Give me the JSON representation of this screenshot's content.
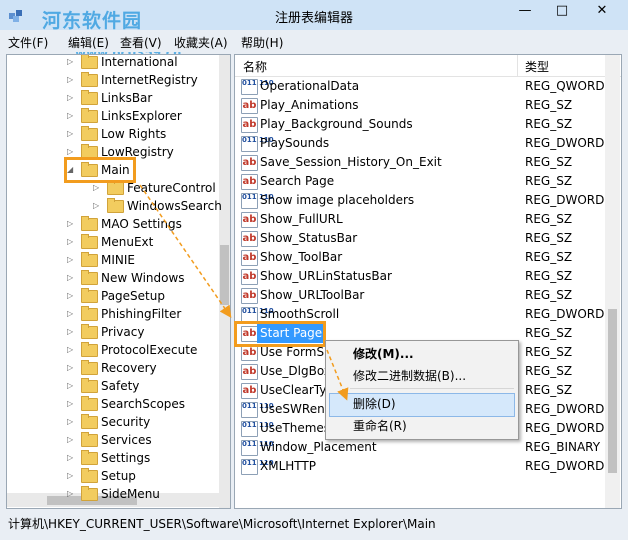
{
  "window": {
    "title": "注册表编辑器",
    "watermark": "河东软件园",
    "watermark_url": "www.pc0359.cn",
    "minimize": "—",
    "restore": "□",
    "close": "✕"
  },
  "menu": [
    "文件(F)",
    "编辑(E)",
    "查看(V)",
    "收藏夹(A)",
    "帮助(H)"
  ],
  "tree": [
    {
      "label": "International",
      "level": 1
    },
    {
      "label": "InternetRegistry",
      "level": 1
    },
    {
      "label": "LinksBar",
      "level": 1
    },
    {
      "label": "LinksExplorer",
      "level": 1
    },
    {
      "label": "Low Rights",
      "level": 1
    },
    {
      "label": "LowRegistry",
      "level": 1
    },
    {
      "label": "Main",
      "level": 1,
      "expanded": true,
      "highlighted": true
    },
    {
      "label": "FeatureControl",
      "level": 2
    },
    {
      "label": "WindowsSearch",
      "level": 2
    },
    {
      "label": "MAO Settings",
      "level": 1
    },
    {
      "label": "MenuExt",
      "level": 1
    },
    {
      "label": "MINIE",
      "level": 1
    },
    {
      "label": "New Windows",
      "level": 1
    },
    {
      "label": "PageSetup",
      "level": 1
    },
    {
      "label": "PhishingFilter",
      "level": 1
    },
    {
      "label": "Privacy",
      "level": 1
    },
    {
      "label": "ProtocolExecute",
      "level": 1
    },
    {
      "label": "Recovery",
      "level": 1
    },
    {
      "label": "Safety",
      "level": 1
    },
    {
      "label": "SearchScopes",
      "level": 1
    },
    {
      "label": "Security",
      "level": 1
    },
    {
      "label": "Services",
      "level": 1
    },
    {
      "label": "Settings",
      "level": 1
    },
    {
      "label": "Setup",
      "level": 1
    },
    {
      "label": "SideMenu",
      "level": 1
    }
  ],
  "list_header": {
    "name": "名称",
    "type": "类型"
  },
  "values": [
    {
      "name": "OperationalData",
      "type": "REG_QWORD",
      "icon": "bin"
    },
    {
      "name": "Play_Animations",
      "type": "REG_SZ",
      "icon": "ab"
    },
    {
      "name": "Play_Background_Sounds",
      "type": "REG_SZ",
      "icon": "ab"
    },
    {
      "name": "PlaySounds",
      "type": "REG_DWORD",
      "icon": "bin"
    },
    {
      "name": "Save_Session_History_On_Exit",
      "type": "REG_SZ",
      "icon": "ab"
    },
    {
      "name": "Search Page",
      "type": "REG_SZ",
      "icon": "ab"
    },
    {
      "name": "Show image placeholders",
      "type": "REG_DWORD",
      "icon": "bin"
    },
    {
      "name": "Show_FullURL",
      "type": "REG_SZ",
      "icon": "ab"
    },
    {
      "name": "Show_StatusBar",
      "type": "REG_SZ",
      "icon": "ab"
    },
    {
      "name": "Show_ToolBar",
      "type": "REG_SZ",
      "icon": "ab"
    },
    {
      "name": "Show_URLinStatusBar",
      "type": "REG_SZ",
      "icon": "ab"
    },
    {
      "name": "Show_URLToolBar",
      "type": "REG_SZ",
      "icon": "ab"
    },
    {
      "name": "SmoothScroll",
      "type": "REG_DWORD",
      "icon": "bin"
    },
    {
      "name": "Start Page",
      "type": "REG_SZ",
      "icon": "ab",
      "selected": true
    },
    {
      "name": "Use FormSuggest",
      "type": "REG_SZ",
      "icon": "ab"
    },
    {
      "name": "Use_DlgBox_Colors",
      "type": "REG_SZ",
      "icon": "ab"
    },
    {
      "name": "UseClearType",
      "type": "REG_SZ",
      "icon": "ab"
    },
    {
      "name": "UseSWRender",
      "type": "REG_DWORD",
      "icon": "bin"
    },
    {
      "name": "UseThemes",
      "type": "REG_DWORD",
      "icon": "bin"
    },
    {
      "name": "Window_Placement",
      "type": "REG_BINARY",
      "icon": "bin"
    },
    {
      "name": "XMLHTTP",
      "type": "REG_DWORD",
      "icon": "bin"
    }
  ],
  "context_menu": [
    {
      "label": "修改(M)...",
      "bold": true
    },
    {
      "label": "修改二进制数据(B)..."
    },
    {
      "label": "删除(D)",
      "highlighted": true
    },
    {
      "label": "重命名(R)"
    }
  ],
  "status": "计算机\\HKEY_CURRENT_USER\\Software\\Microsoft\\Internet Explorer\\Main",
  "colors": {
    "highlight_box": "#f29c1e",
    "selection": "#3399ff"
  }
}
